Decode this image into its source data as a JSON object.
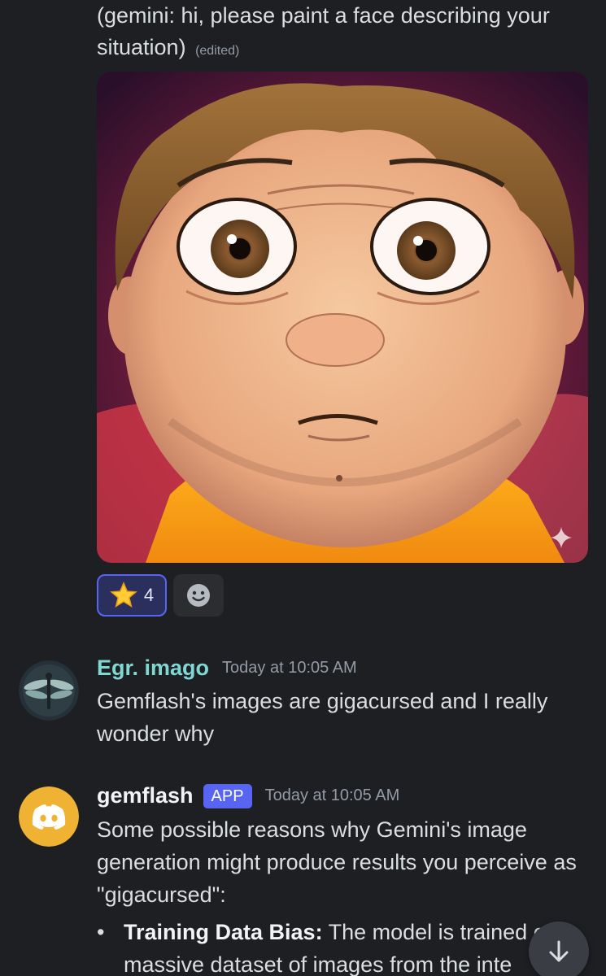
{
  "previous_message": {
    "text": "(gemini: hi, please paint a face describing your situation)",
    "edited_label": "(edited)"
  },
  "reactions": [
    {
      "emoji": "star-icon",
      "count": "4",
      "selected": true
    },
    {
      "emoji": "add-reaction-icon"
    }
  ],
  "messages": [
    {
      "username": "Egr. imago",
      "timestamp": "Today at 10:05 AM",
      "avatar": "dragonfly-avatar",
      "text": "Gemflash's images are gigacursed and I really wonder why"
    },
    {
      "username": "gemflash",
      "badge": "APP",
      "timestamp": "Today at 10:05 AM",
      "avatar": "discord-logo-avatar",
      "text": "Some possible reasons why Gemini's image generation might produce results you perceive as \"gigacursed\":",
      "bullets": [
        {
          "title": "Training Data Bias:",
          "text": " The model is trained on a massive dataset of images from the inte"
        }
      ]
    }
  ],
  "colors": {
    "background": "#1e1f23",
    "accent": "#5865f2",
    "username_teal": "#7fd8d2",
    "discord_orange": "#f0b232"
  }
}
